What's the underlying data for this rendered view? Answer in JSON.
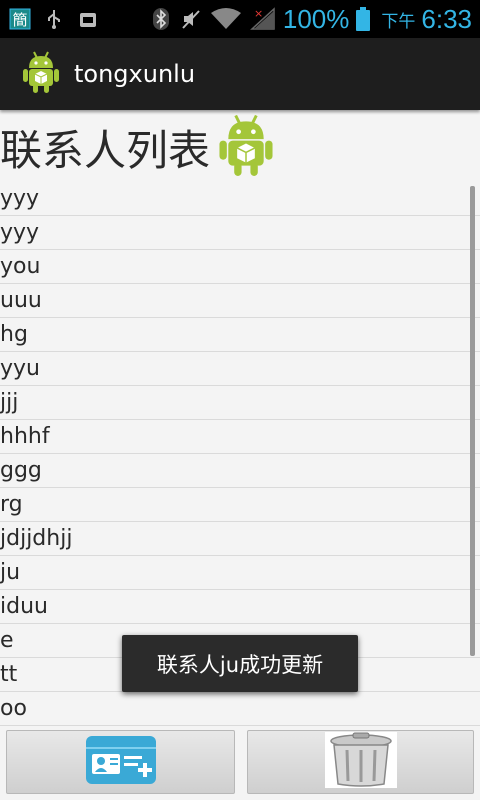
{
  "status_bar": {
    "battery_percent": "100%",
    "ampm": "下午",
    "time": "6:33",
    "icons": [
      "sim-icon",
      "usb-icon",
      "debug-icon",
      "bluetooth-icon",
      "mute-icon",
      "wifi-icon",
      "no-signal-icon",
      "battery-icon"
    ]
  },
  "action_bar": {
    "title": "tongxunlu",
    "icon": "android-icon"
  },
  "header": {
    "title": "联系人列表",
    "icon": "android-icon"
  },
  "contacts": [
    "yyy",
    "yyy",
    "you",
    "uuu",
    "hg",
    "yyu",
    "jjj",
    "hhhf",
    "ggg",
    "rg",
    "jdjjdhjj",
    "ju",
    "iduu",
    "e",
    "tt",
    "oo"
  ],
  "toast": {
    "message": "联系人ju成功更新"
  },
  "bottom_bar": {
    "add_button_icon": "add-contact-icon",
    "delete_button_icon": "trash-icon"
  },
  "colors": {
    "status_accent": "#33b5e5",
    "action_bar_bg": "#1e1e1e",
    "android_green": "#a4c639"
  }
}
